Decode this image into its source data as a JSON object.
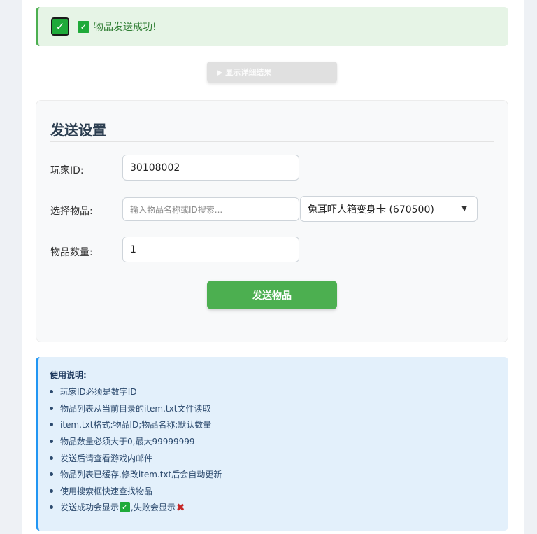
{
  "alert": {
    "message": "物品发送成功!"
  },
  "details_toggle": {
    "label": "▶ 显示详细结果"
  },
  "settings": {
    "title": "发送设置",
    "player_id": {
      "label": "玩家ID:",
      "value": "30108002"
    },
    "item": {
      "label": "选择物品:",
      "search_placeholder": "输入物品名称或ID搜索...",
      "selected": "兔耳吓人箱变身卡 (670500)"
    },
    "quantity": {
      "label": "物品数量:",
      "value": "1"
    },
    "send_label": "发送物品"
  },
  "instructions": {
    "title": "使用说明:",
    "items": [
      "玩家ID必须是数字ID",
      "物品列表从当前目录的item.txt文件读取",
      "item.txt格式:物品ID;物品名称;默认数量",
      "物品数量必须大于0,最大99999999",
      "发送后请查看游戏内邮件",
      "物品列表已缓存,修改item.txt后会自动更新",
      "使用搜索框快速查找物品"
    ],
    "last_item_part1": "发送成功会显示",
    "last_item_part2": ",失败会显示"
  },
  "colors": {
    "success": "#4caf50",
    "info": "#2196f3",
    "fail": "#c62828"
  },
  "icons": {
    "success": "check-box-icon",
    "fail": "cross-mark-icon",
    "caret": "caret-down-icon"
  }
}
